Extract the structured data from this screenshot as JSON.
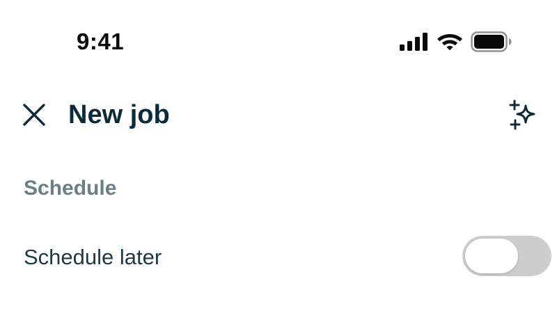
{
  "status_bar": {
    "time": "9:41",
    "icons": [
      "signal-icon",
      "wifi-icon",
      "battery-icon"
    ]
  },
  "header": {
    "close_icon": "close-icon",
    "title": "New job",
    "action_icon": "sparkles-icon"
  },
  "section": {
    "heading": "Schedule",
    "rows": [
      {
        "label": "Schedule later",
        "control": "toggle",
        "checked": false
      }
    ]
  },
  "colors": {
    "title": "#0b2a3c",
    "section_heading": "#6a7f86",
    "label": "#1f3844",
    "toggle_off_track": "#cdcdcd",
    "toggle_knob": "#ffffff",
    "background": "#ffffff"
  }
}
